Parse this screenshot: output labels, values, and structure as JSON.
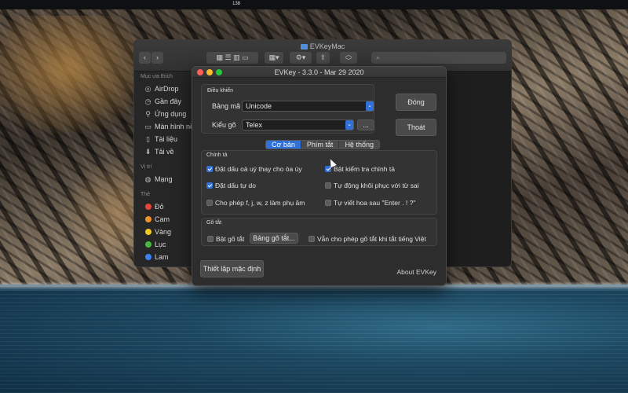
{
  "desktop": {
    "menubar_text": "138"
  },
  "finder": {
    "title": "EVKeyMac",
    "search_placeholder": "Search",
    "sidebar": {
      "favorites_header": "Mục ưa thích",
      "favorites": [
        {
          "label": "AirDrop",
          "icon": "airdrop-icon"
        },
        {
          "label": "Gần đây",
          "icon": "clock-icon"
        },
        {
          "label": "Ứng dụng",
          "icon": "applications-icon"
        },
        {
          "label": "Màn hình nề",
          "icon": "desktop-icon"
        },
        {
          "label": "Tài liệu",
          "icon": "document-icon"
        },
        {
          "label": "Tải về",
          "icon": "download-icon"
        }
      ],
      "locations_header": "Vị trí",
      "locations": [
        {
          "label": "Mạng",
          "icon": "network-icon"
        }
      ],
      "tags_header": "Thẻ",
      "tags": [
        {
          "label": "Đỏ",
          "color": "#e5443b"
        },
        {
          "label": "Cam",
          "color": "#f0932b"
        },
        {
          "label": "Vàng",
          "color": "#f3c623"
        },
        {
          "label": "Lục",
          "color": "#49b83f"
        },
        {
          "label": "Lam",
          "color": "#3b82f6"
        }
      ]
    }
  },
  "evkey": {
    "title": "EVKey - 3.3.0 - Mar 29 2020",
    "control_group": {
      "label": "Điều khiển",
      "charset_label": "Bảng mã",
      "charset_value": "Unicode",
      "input_label": "Kiểu gõ",
      "input_value": "Telex",
      "more_button": "..."
    },
    "close_button": "Đóng",
    "quit_button": "Thoát",
    "tabs": [
      {
        "label": "Cơ bản",
        "active": true
      },
      {
        "label": "Phím tắt",
        "active": false
      },
      {
        "label": "Hệ thống",
        "active": false
      }
    ],
    "spelling_group": {
      "label": "Chính tả",
      "options": [
        {
          "label": "Đặt dấu oà uý thay cho òa úy",
          "checked": true
        },
        {
          "label": "Bật kiểm tra chính tả",
          "checked": true
        },
        {
          "label": "Đặt dấu tự do",
          "checked": true
        },
        {
          "label": "Tự động khôi phục với từ sai",
          "checked": false
        },
        {
          "label": "Cho phép f, j, w, z làm phụ âm",
          "checked": false
        },
        {
          "label": "Tự viết hoa sau \"Enter . ! ?\"",
          "checked": false
        }
      ]
    },
    "shortcut_group": {
      "label": "Gõ tắt",
      "enable_label": "Bật gõ tắt",
      "enable_checked": false,
      "table_button": "Bảng gõ tắt...",
      "still_allow_label": "Vẫn cho phép gõ tắt khi tắt tiếng Việt",
      "still_allow_checked": false
    },
    "reset_button": "Thiết lập mặc định",
    "about_link": "About EVKey"
  }
}
